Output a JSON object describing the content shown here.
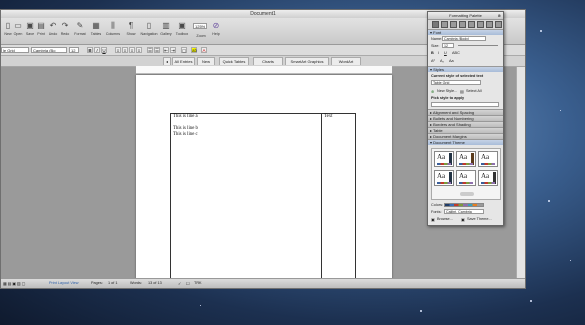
{
  "window": {
    "title": "Document1"
  },
  "toolbar": {
    "buttons": [
      {
        "label": "New",
        "icon": "new-doc-icon"
      },
      {
        "label": "Open",
        "icon": "open-folder-icon"
      },
      {
        "label": "Save",
        "icon": "save-icon"
      },
      {
        "label": "Print",
        "icon": "print-icon"
      },
      {
        "label": "Undo",
        "icon": "undo-icon"
      },
      {
        "label": "Redo",
        "icon": "redo-icon"
      },
      {
        "label": "Format",
        "icon": "format-brush-icon"
      },
      {
        "label": "Tables",
        "icon": "table-icon"
      },
      {
        "label": "Columns",
        "icon": "columns-icon"
      },
      {
        "label": "Show",
        "icon": "pilcrow-icon"
      },
      {
        "label": "Navigation",
        "icon": "navigation-icon"
      },
      {
        "label": "Gallery",
        "icon": "gallery-icon"
      },
      {
        "label": "Toolbox",
        "icon": "toolbox-icon"
      },
      {
        "label": "Zoom",
        "icon": "zoom-icon"
      },
      {
        "label": "Help",
        "icon": "help-icon"
      }
    ],
    "zoom_value": "125%"
  },
  "format_bar": {
    "style_value": "le Grid",
    "font_value": "Cambria (Bo",
    "size_value": "12"
  },
  "ribbon": {
    "tabs": [
      "All Entries",
      "New",
      "Quick Tables",
      "Charts",
      "SmartArt Graphics",
      "WordArt"
    ]
  },
  "document": {
    "cell_lines": [
      "This is line a",
      "This is line b",
      "This is line c"
    ],
    "right_cell": "Text"
  },
  "status": {
    "view": "Print Layout View",
    "pages_label": "Pages:",
    "pages_value": "1 of 1",
    "words_label": "Words:",
    "words_value": "13 of 13",
    "track": "TRK"
  },
  "palette": {
    "title": "Formatting Palette",
    "font_section": "Font",
    "name_label": "Name:",
    "name_value": "Cambria (Body)",
    "size_label": "Size:",
    "size_value": "12",
    "styles_section": "Styles",
    "current_style_label": "Current style of selected text",
    "current_style_value": "Table Grid",
    "new_style": "New Style...",
    "select_all": "Select All",
    "pick_style_label": "Pick style to apply",
    "sections": [
      "Alignment and Spacing",
      "Bullets and Numbering",
      "Borders and Shading",
      "Table",
      "Document Margins"
    ],
    "theme_section": "Document Theme",
    "theme_sample": "Aa",
    "colors_label": "Colors:",
    "fonts_label": "Fonts:",
    "fonts_value": "Calibri, Cambria",
    "browse": "Browse...",
    "save_theme": "Save Theme..."
  },
  "colors": {
    "accent": "#3b6fb6",
    "desktop": "#3a5f8f"
  }
}
